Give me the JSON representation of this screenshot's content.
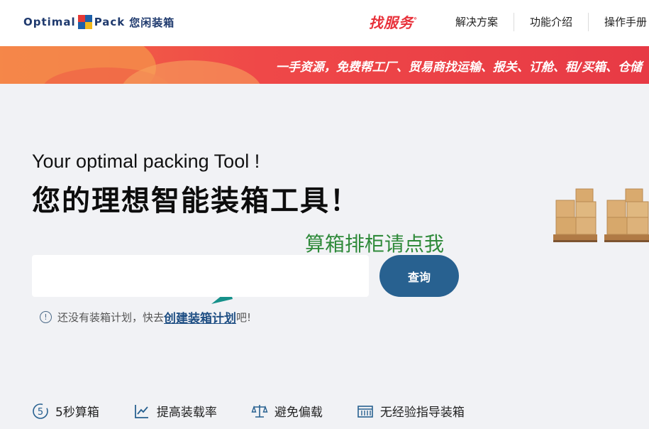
{
  "header": {
    "logo_prefix": "Optimal",
    "logo_suffix": "Pack",
    "logo_cn": "您闲装箱",
    "service_label": "找服务",
    "nav": [
      "解决方案",
      "功能介绍",
      "操作手册"
    ]
  },
  "banner": {
    "text": "一手资源，免费帮工厂、贸易商找运输、报关、订舱、租/买箱、仓储"
  },
  "hero": {
    "subtitle_en": "Your optimal packing Tool !",
    "title_cn": "您的理想智能装箱工具！",
    "annotation": "算箱排柜请点我"
  },
  "search": {
    "value": "",
    "placeholder": "",
    "button_label": "查询"
  },
  "tip": {
    "icon": "!",
    "prefix": "还没有装箱计划，快去",
    "link": "创建装箱计划",
    "suffix": "吧!"
  },
  "features": [
    {
      "icon": "five-seconds-icon",
      "label": "5秒算箱"
    },
    {
      "icon": "chart-line-icon",
      "label": "提高装载率"
    },
    {
      "icon": "balance-scale-icon",
      "label": "避免偏载"
    },
    {
      "icon": "container-icon",
      "label": "无经验指导装箱"
    }
  ],
  "colors": {
    "primary": "#286190",
    "service_red": "#e8313a",
    "annotation_green": "#2f8a3a",
    "arrow_teal": "#16918a"
  }
}
